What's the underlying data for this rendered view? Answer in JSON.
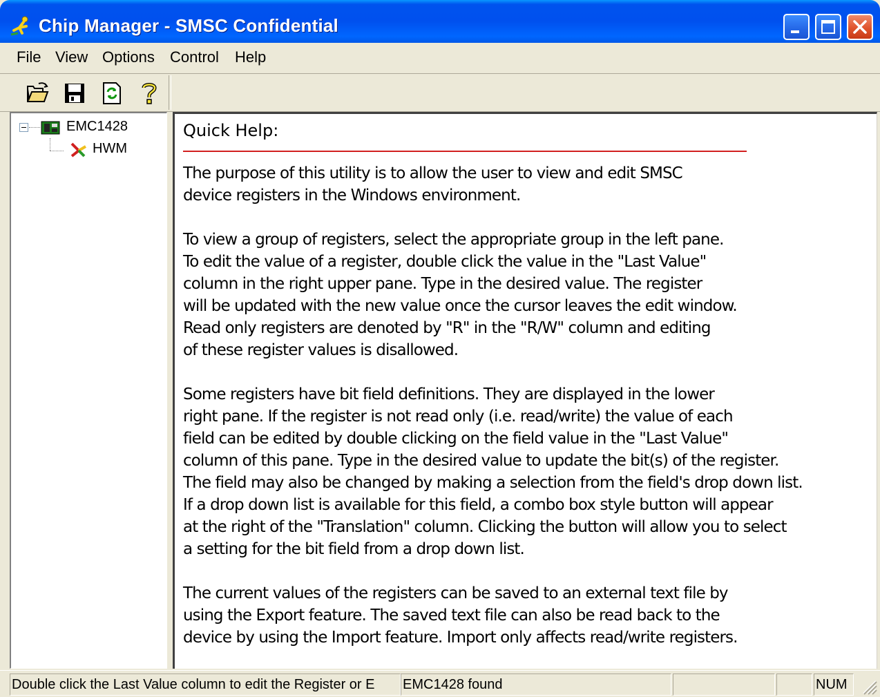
{
  "window": {
    "title": "Chip Manager - SMSC Confidential"
  },
  "menu": {
    "items": [
      "File",
      "View",
      "Options",
      "Control",
      "Help"
    ]
  },
  "toolbar": {
    "icons": [
      "open-folder-icon",
      "save-icon",
      "refresh-icon",
      "help-icon"
    ]
  },
  "tree": {
    "root": "EMC1428",
    "child": "HWM"
  },
  "help": {
    "title": "Quick Help:",
    "rule_color": "#d21f1f",
    "paragraphs": [
      [
        "The purpose of this utility is to allow the user to view and edit SMSC",
        "device registers in the Windows environment."
      ],
      [
        "To view a group of registers, select the appropriate group in the left pane.",
        "To edit the value of a register, double click the value in the \"Last Value\"",
        "column in the right upper pane. Type in the desired value. The register",
        "will be updated with the new value once the cursor leaves the edit window.",
        "Read only registers are denoted by \"R\" in the \"R/W\" column and editing",
        "of these register values is disallowed."
      ],
      [
        "Some registers have bit field definitions. They are displayed in the lower",
        "right pane. If the register is not read only (i.e. read/write) the value of each",
        "field can be edited by double clicking on the field value in the \"Last Value\"",
        "column of this pane. Type in the desired value to update the bit(s) of the register.",
        "The field may also be changed by making a selection from the field's drop down list.",
        "If a drop down list is available for this field, a combo box style button will appear",
        "at the right of the \"Translation\" column.  Clicking the button will allow you to select",
        "a setting for the bit field from a drop down list."
      ],
      [
        "The current values of the registers can be saved to an external text file by",
        "using the Export feature. The saved text file can also be read back to the",
        "device by using the Import feature. Import only affects read/write registers."
      ]
    ]
  },
  "status": {
    "message": "Double click the Last Value column to edit the Register or E",
    "device": "EMC1428 found",
    "empty1": "",
    "empty2": "",
    "num": "NUM"
  }
}
